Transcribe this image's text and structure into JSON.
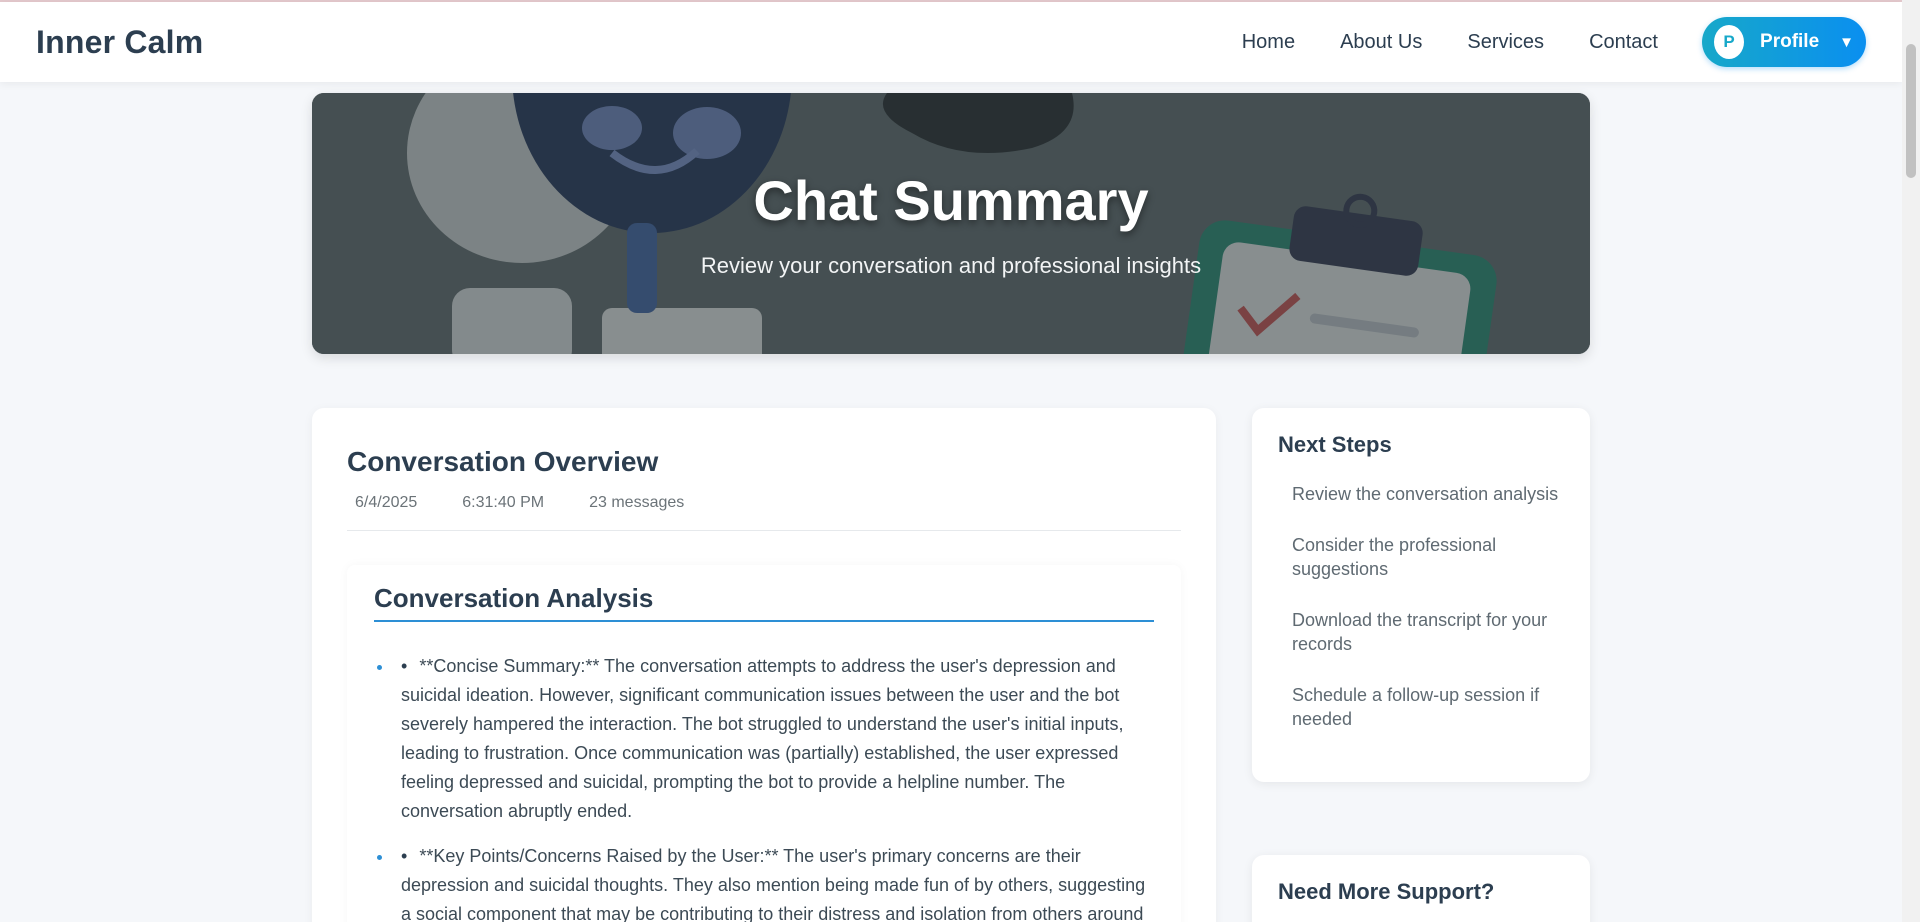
{
  "nav": {
    "brand": "Inner Calm",
    "links": [
      "Home",
      "About Us",
      "Services",
      "Contact"
    ],
    "profile": {
      "avatar_letter": "P",
      "label": "Profile",
      "caret": "▼"
    }
  },
  "hero": {
    "title": "Chat Summary",
    "subtitle": "Review your conversation and professional insights"
  },
  "overview": {
    "title": "Conversation Overview",
    "date": "6/4/2025",
    "time": "6:31:40 PM",
    "messages": "23 messages"
  },
  "analysis": {
    "title": "Conversation Analysis",
    "bullet_glyph": "•",
    "items": [
      "**Concise Summary:** The conversation attempts to address the user's depression and suicidal ideation. However, significant communication issues between the user and the bot severely hampered the interaction. The bot struggled to understand the user's initial inputs, leading to frustration. Once communication was (partially) established, the user expressed feeling depressed and suicidal, prompting the bot to provide a helpline number. The conversation abruptly ended.",
      "**Key Points/Concerns Raised by the User:** The user's primary concerns are their depression and suicidal thoughts. They also mention being made fun of by others, suggesting a social component that may be contributing to their distress and isolation from others around them."
    ]
  },
  "next_steps": {
    "title": "Next Steps",
    "items": [
      "Review the conversation analysis",
      "Consider the professional suggestions",
      "Download the transcript for your records",
      "Schedule a follow-up session if needed"
    ]
  },
  "support": {
    "title": "Need More Support?"
  },
  "colors": {
    "accent": "#2d8fd5",
    "profile_gradient_start": "#17a8c9",
    "profile_gradient_end": "#0a8ff0"
  }
}
